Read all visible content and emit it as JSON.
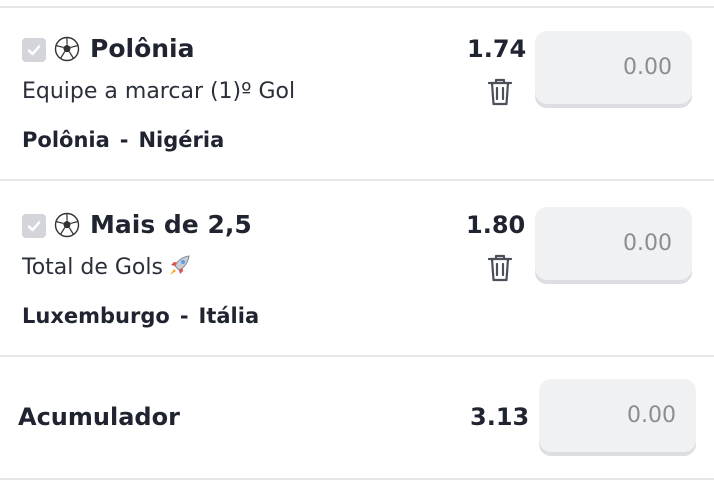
{
  "bets": [
    {
      "selection": "Polônia",
      "market": "Equipe a marcar (1)º Gol",
      "market_icon": "",
      "home": "Polônia",
      "away": "Nigéria",
      "separator": "-",
      "odds": "1.74",
      "stake_placeholder": "0.00"
    },
    {
      "selection": "Mais de 2,5",
      "market": "Total de Gols",
      "market_icon": "rocket-icon",
      "home": "Luxemburgo",
      "away": "Itália",
      "separator": "-",
      "odds": "1.80",
      "stake_placeholder": "0.00"
    }
  ],
  "accumulator": {
    "label": "Acumulador",
    "odds": "3.13",
    "stake_placeholder": "0.00"
  },
  "colors": {
    "text": "#1f2430",
    "input_bg": "#f0f1f3",
    "placeholder": "#8a8d94",
    "checkbox": "#d3d5da",
    "divider": "#e4e6ea"
  }
}
